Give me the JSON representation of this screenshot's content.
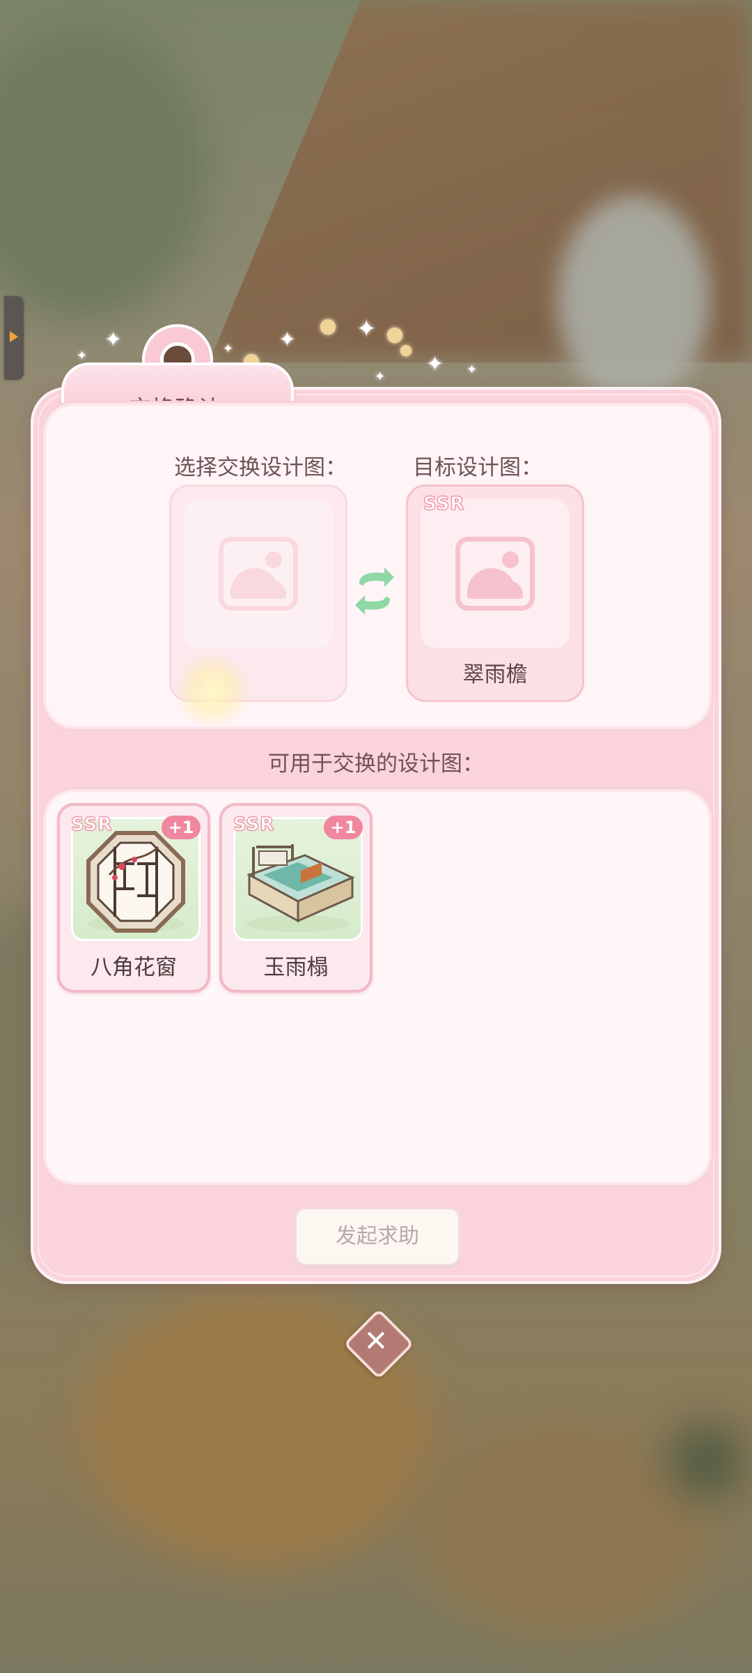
{
  "dialog": {
    "title": "交换确认",
    "select_label": "选择交换设计图：",
    "target_label": "目标设计图：",
    "target_item": {
      "rarity": "SSR",
      "name": "翠雨檐"
    },
    "available_label": "可用于交换的设计图：",
    "available_items": [
      {
        "rarity": "SSR",
        "count": "+1",
        "name": "八角花窗",
        "icon": "octagonal-lattice-window-icon"
      },
      {
        "rarity": "SSR",
        "count": "+1",
        "name": "玉雨榻",
        "icon": "jade-bed-icon"
      }
    ],
    "help_button": "发起求助"
  },
  "colors": {
    "panel": "#fbd3dc",
    "accent": "#f0879f",
    "text": "#6e5357"
  }
}
